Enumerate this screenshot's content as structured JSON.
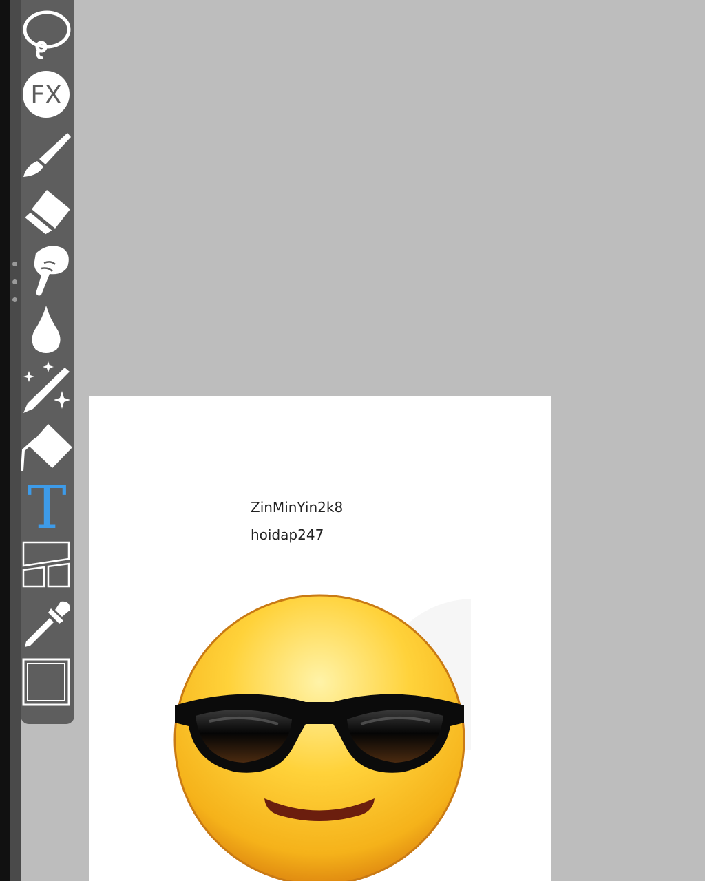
{
  "toolbar": {
    "fx_label": "FX",
    "text_tool_glyph": "T",
    "tools": [
      {
        "icon": "lasso-icon"
      },
      {
        "icon": "fx-icon"
      },
      {
        "icon": "brush-icon"
      },
      {
        "icon": "eraser-icon"
      },
      {
        "icon": "smudge-finger-icon"
      },
      {
        "icon": "blur-drop-icon"
      },
      {
        "icon": "magic-pen-icon"
      },
      {
        "icon": "fill-bucket-icon"
      },
      {
        "icon": "text-icon",
        "selected": true
      },
      {
        "icon": "frame-divider-icon"
      },
      {
        "icon": "eyedropper-icon"
      },
      {
        "icon": "canvas-icon"
      }
    ]
  },
  "colors": {
    "workspace_bg": "#bdbdbd",
    "toolbar_bg": "#5e5e5e",
    "icon": "#ffffff",
    "selected_tool": "#3d9be9",
    "canvas": "#ffffff"
  },
  "canvas": {
    "text_lines": [
      "ZinMinYin2k8",
      "hoidap247"
    ],
    "emoji": "smiling-face-with-sunglasses-emoji"
  }
}
